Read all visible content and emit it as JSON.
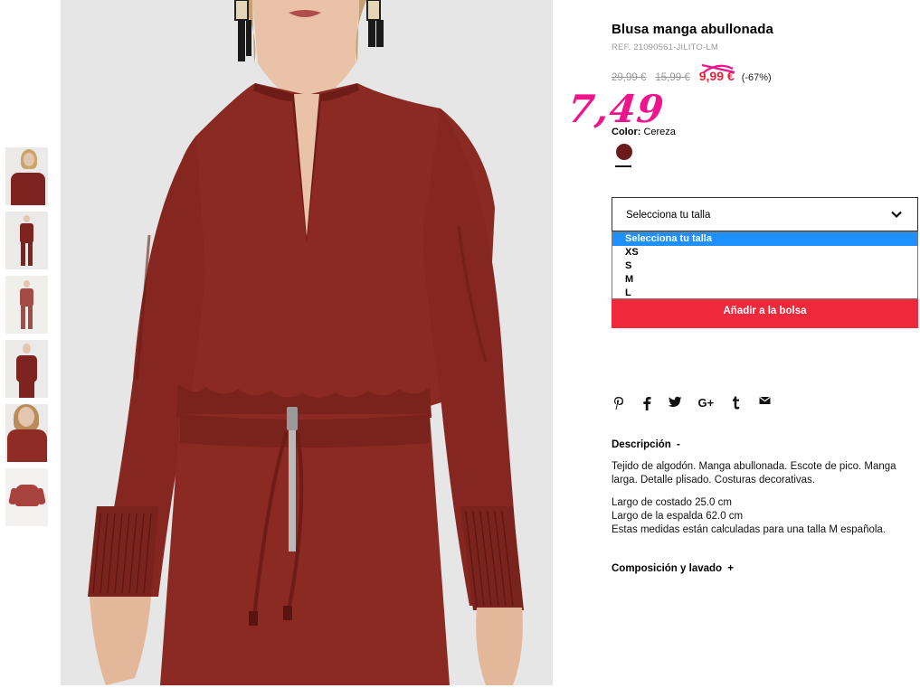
{
  "product": {
    "title": "Blusa manga abullonada",
    "ref": "REF. 21090561-JILITO-LM",
    "price_original": "29,99 €",
    "price_previous": "15,99 €",
    "price_sale": "9,99 €",
    "discount": "(-67%)",
    "handwritten_price": "7,49"
  },
  "color": {
    "label": "Color:",
    "value": "Cereza",
    "swatch_hex": "#6b1a1a"
  },
  "size_select": {
    "selected": "Selecciona tu talla",
    "options": [
      "Selecciona tu talla",
      "XS",
      "S",
      "M",
      "L"
    ]
  },
  "add_to_bag": "Añadir a la bolsa",
  "social": {
    "icons": [
      "pinterest-icon",
      "facebook-icon",
      "twitter-icon",
      "google-plus-icon",
      "tumblr-icon",
      "email-icon"
    ],
    "google_plus_text": "G+"
  },
  "description": {
    "heading": "Descripción",
    "toggle": "-",
    "text": "Tejido de algodón. Manga abullonada. Escote de pico. Manga larga. Detalle plisado. Costuras decorativas.",
    "measures": [
      "Largo de costado 25.0 cm",
      "Largo de la espalda 62.0 cm",
      "Estas medidas están calculadas para una talla M española."
    ]
  },
  "composition": {
    "heading": "Composición y lavado",
    "toggle": "+"
  },
  "colors": {
    "garment": "#8a2a22",
    "sale_red": "#e8243c",
    "button_red": "#f0283c",
    "handwritten_pink": "#f0148c",
    "selected_option_blue": "#1e90ff"
  },
  "thumbnails": [
    "thumb-portrait-front",
    "thumb-full-body",
    "thumb-full-body-light",
    "thumb-three-quarter",
    "thumb-closeup",
    "thumb-product-flat"
  ]
}
